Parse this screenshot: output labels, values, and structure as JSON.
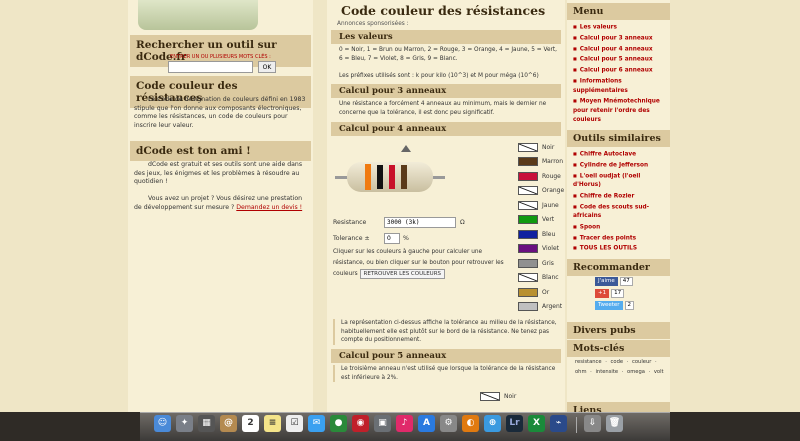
{
  "left": {
    "search_title": "Rechercher un outil sur dCode.fr",
    "search_hint": "ENTRER UN OU PLUSIEURS MOTS CLÉS :",
    "ok": "OK",
    "code_title": "Code couleur des résistances",
    "code_text": "Le Code de désignation de couleurs défini en 1983 stipule que l'on donne aux composants électroniques, comme les résistances, un code de couleurs pour inscrire leur valeur.",
    "friend_title": "dCode est ton ami !",
    "friend_text1": "dCode est gratuit et ses outils sont une aide dans des jeux, les énigmes et les problèmes à résoudre au quotidien !",
    "friend_text2": "Vous avez un projet ? Vous désirez une prestation de développement sur mesure ?",
    "friend_link": "Demandez un devis !"
  },
  "main": {
    "title": "Code couleur des résistances",
    "ads": "Annonces sponsorisées :",
    "valeurs_title": "Les valeurs",
    "valeurs_text": "0 = Noir, 1 = Brun ou Marron, 2 = Rouge, 3 = Orange, 4 = Jaune, 5 = Vert, 6 = Bleu, 7 = Violet, 8 = Gris, 9 = Blanc.",
    "prefix_text": "Les préfixes utilisés sont : k pour kilo (10^3) et M pour méga (10^6)",
    "calc3_title": "Calcul pour 3 anneaux",
    "calc3_text": "Une résistance a forcément 4 anneaux au minimum, mais le dernier ne concerne que la tolérance, il est donc peu significatif.",
    "calc4_title": "Calcul pour 4 anneaux",
    "resistance_label": "Resistance",
    "resistance_value": "3000 (3k)",
    "ohm": "Ω",
    "tolerance_label": "Tolerance ±",
    "tolerance_value": "0",
    "percent": "%",
    "click_text1": "Cliquer sur les couleurs à gauche pour calculer une résistance, ou bien cliquer sur le bouton pour retrouver les couleurs",
    "retrouver_button": "RETROUVER LES COULEURS",
    "note_text": "La représentation ci-dessus affiche la tolérance au milieu de la résistance, habituellement elle est plutôt sur le bord de la résistance. Ne tenez pas compte du positionnement.",
    "calc5_title": "Calcul pour 5 anneaux",
    "calc5_text": "Le troisième anneau n'est utilisé que lorsque la tolérance de la résistance est inférieure à 2%.",
    "noir_bottom": "Noir"
  },
  "colors": [
    {
      "name": "Noir",
      "hex": "#ffffff",
      "diag": true
    },
    {
      "name": "Marron",
      "hex": "#5a3a1a"
    },
    {
      "name": "Rouge",
      "hex": "#c8103a"
    },
    {
      "name": "Orange",
      "hex": "#ffffff",
      "diag": true
    },
    {
      "name": "Jaune",
      "hex": "#ffffff",
      "diag": true
    },
    {
      "name": "Vert",
      "hex": "#109a10"
    },
    {
      "name": "Bleu",
      "hex": "#1020a0"
    },
    {
      "name": "Violet",
      "hex": "#6a1080"
    },
    {
      "name": "Gris",
      "hex": "#909090"
    },
    {
      "name": "Blanc",
      "hex": "#ffffff",
      "diag": true
    },
    {
      "name": "Or",
      "hex": "#b89030"
    },
    {
      "name": "Argent",
      "hex": "#c0c0c0"
    }
  ],
  "right": {
    "menu_title": "Menu",
    "menu": [
      "Les valeurs",
      "Calcul pour 3 anneaux",
      "Calcul pour 4 anneaux",
      "Calcul pour 5 anneaux",
      "Calcul pour 6 anneaux",
      "Informations supplémentaires",
      "Moyen Mnémotechnique pour retenir l'ordre des couleurs"
    ],
    "tools_title": "Outils similaires",
    "tools": [
      "Chiffre Autoclave",
      "Cylindre de Jefferson",
      "L'oeil oudjat (l'oeil d'Horus)",
      "Chiffre de Rozier",
      "Code des scouts sud-africains",
      "Spoon",
      "Tracer des points",
      "TOUS LES OUTILS"
    ],
    "reco_title": "Recommander",
    "like": "J'aime",
    "like_count": "47",
    "gplus": "+1",
    "gplus_count": "17",
    "tweet": "Tweeter",
    "tweet_count": "2",
    "pubs_title": "Divers pubs",
    "mots_title": "Mots-clés",
    "mots": "resistance · code · couleur · ohm · intensite · omega · volt",
    "liens_title": "Liens"
  }
}
